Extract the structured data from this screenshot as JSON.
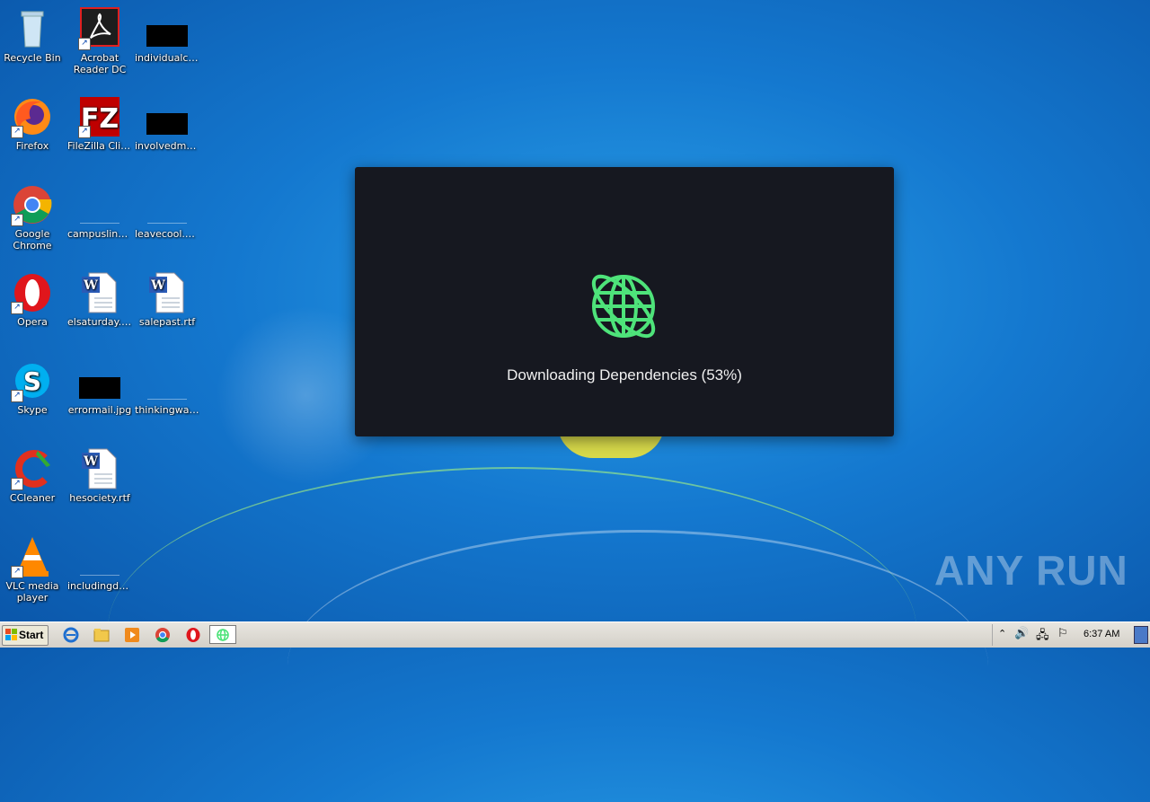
{
  "desktop": {
    "icons": [
      {
        "label": "Recycle Bin",
        "icon": "recycle-bin-icon"
      },
      {
        "label": "Acrobat Reader DC",
        "icon": "acrobat-icon"
      },
      {
        "label": "individualcol...",
        "icon": "file-icon"
      },
      {
        "label": "Firefox",
        "icon": "firefox-icon"
      },
      {
        "label": "FileZilla Client",
        "icon": "filezilla-icon"
      },
      {
        "label": "involvedmm...",
        "icon": "file-icon"
      },
      {
        "label": "Google Chrome",
        "icon": "chrome-icon"
      },
      {
        "label": "campuslink...",
        "icon": "file-icon"
      },
      {
        "label": "leavecool.png",
        "icon": "image-file-icon"
      },
      {
        "label": "Opera",
        "icon": "opera-icon"
      },
      {
        "label": "elsaturday.rtf",
        "icon": "word-doc-icon"
      },
      {
        "label": "salepast.rtf",
        "icon": "word-doc-icon"
      },
      {
        "label": "Skype",
        "icon": "skype-icon"
      },
      {
        "label": "errormail.jpg",
        "icon": "image-file-icon"
      },
      {
        "label": "thinkingwar....",
        "icon": "file-icon"
      },
      {
        "label": "CCleaner",
        "icon": "ccleaner-icon"
      },
      {
        "label": "hesociety.rtf",
        "icon": "word-doc-icon"
      },
      {
        "label": "VLC media player",
        "icon": "vlc-icon"
      },
      {
        "label": "includingda...",
        "icon": "file-icon"
      }
    ]
  },
  "dialog": {
    "status": "Downloading Dependencies (53%)",
    "progress_percent": 53,
    "icon": "globe-icon",
    "accent": "#4ee37a",
    "background": "#161820"
  },
  "taskbar": {
    "start_label": "Start",
    "clock": "6:37 AM"
  },
  "watermark": "ANY RUN"
}
